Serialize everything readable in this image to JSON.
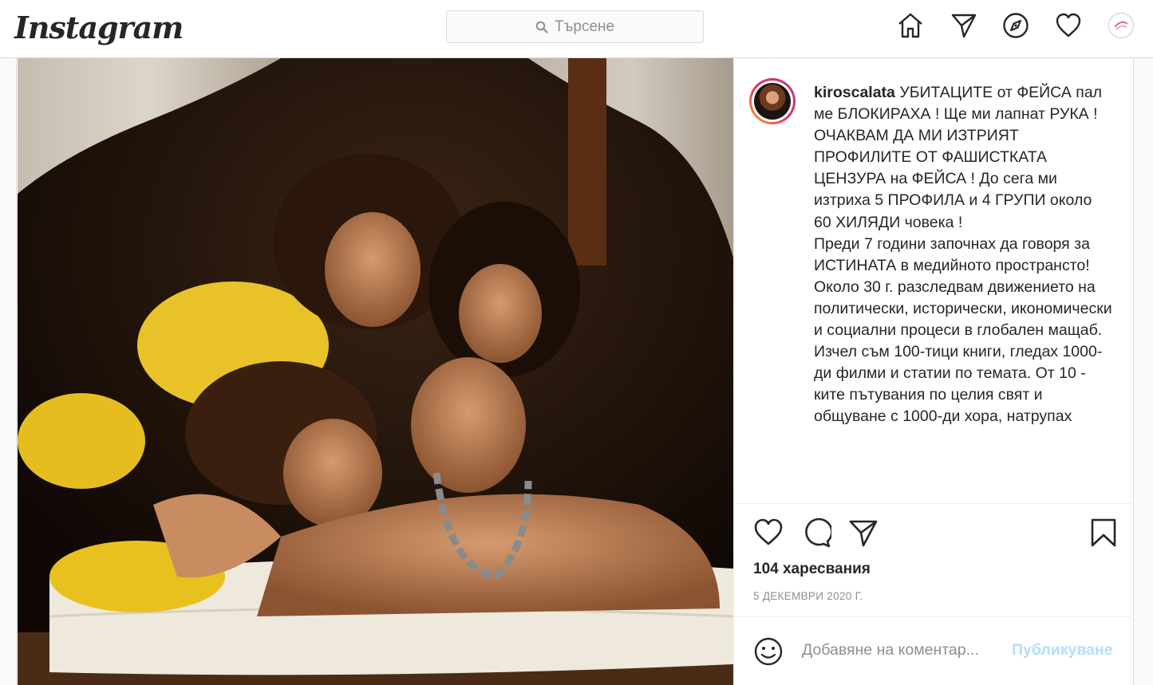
{
  "nav": {
    "logo": "Instagram",
    "search_placeholder": "Търсене",
    "icons": [
      "home-icon",
      "direct-icon",
      "explore-icon",
      "activity-icon",
      "profile-avatar"
    ]
  },
  "post": {
    "username": "kiroscalata",
    "caption": "УБИТАЦИТЕ от ФЕЙСА пал ме БЛОКИРАХА ! Ще ми лапнат РУКА !\nОЧАКВАМ ДА МИ ИЗТРИЯТ ПРОФИЛИТЕ ОТ ФАШИСТКАТА ЦЕНЗУРА на ФЕЙСА ! До сега ми изтриха 5 ПРОФИЛА и 4 ГРУПИ около 60 ХИЛЯДИ човека !\nПреди 7 години започнах да говоря за ИСТИНАТА в медийното пространсто! Около 30 г. разследвам движението на политически, исторически, икономически и социални процеси в глобален мащаб. Изчел съм 100-тици книги, гледах 1000-ди филми и статии по темата. От 10 - ките пътувания по целия свят и общуване с 1000-ди хора, натрупах",
    "likes": "104 харесвания",
    "date": "5 ДЕКЕМВРИ 2020 Г.",
    "comment_placeholder": "Добавяне на коментар...",
    "publish_label": "Публикуване"
  },
  "colors": {
    "accent": "#0095f6",
    "publish_disabled": "#b2dffc",
    "border": "#dbdbdb",
    "muted": "#8e8e8e"
  }
}
